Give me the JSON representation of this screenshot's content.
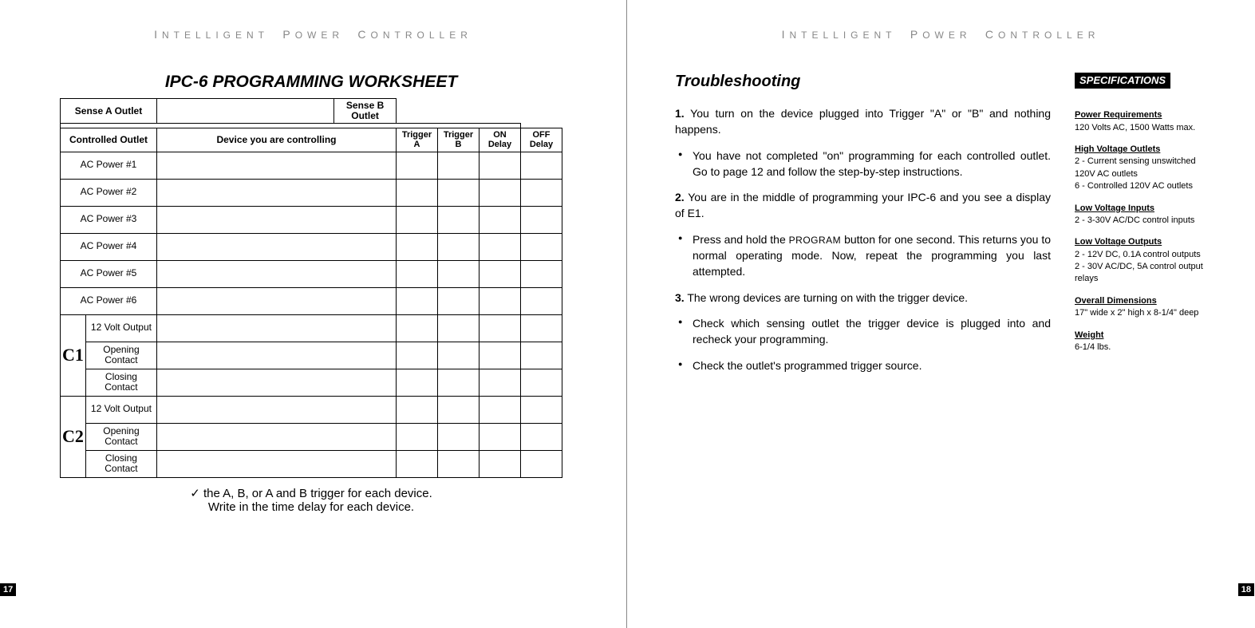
{
  "header": {
    "text": "Intelligent Power Controller"
  },
  "leftPage": {
    "pageNumber": "17",
    "title": "IPC-6 PROGRAMMING WORKSHEET",
    "senseA": "Sense A Outlet",
    "senseB": "Sense B Outlet",
    "colHeaders": {
      "outlet": "Controlled Outlet",
      "device": "Device you are controlling",
      "triggerA": "Trigger A",
      "triggerB": "Trigger B",
      "onDelay": "ON Delay",
      "offDelay": "OFF Delay"
    },
    "rowsSimple": [
      "AC Power #1",
      "AC Power #2",
      "AC Power #3",
      "AC Power #4",
      "AC Power #5",
      "AC Power #6"
    ],
    "groupLabels": {
      "c1": "C1",
      "c2": "C2"
    },
    "groupRows": [
      "12 Volt Output",
      "Opening Contact",
      "Closing Contact"
    ],
    "footnote1": "✓ the A, B, or A and B trigger for each device.",
    "footnote2": "Write in the time delay for each device."
  },
  "rightPage": {
    "pageNumber": "18",
    "tshootTitle": "Troubleshooting",
    "items": [
      {
        "num": "1.",
        "text": "You turn on the device plugged into Trigger \"A\" or \"B\" and nothing happens."
      },
      {
        "bullet": true,
        "text": "You have not completed \"on\" programming for each controlled outlet. Go to page 12 and follow the step-by-step instructions."
      },
      {
        "num": "2.",
        "text": "You are in the middle of programming your IPC-6 and you see a display of E1."
      },
      {
        "bullet": true,
        "textPre": "Press and hold the ",
        "sc": "PROGRAM",
        "textPost": " button for one second. This returns you to normal operating mode. Now, repeat the programming you last attempted."
      },
      {
        "num": "3.",
        "text": "The wrong devices are turning on with the trigger device."
      },
      {
        "bullet": true,
        "text": "Check which sensing outlet the trigger device is plugged into and recheck your programming."
      },
      {
        "bullet": true,
        "text": "Check the outlet's programmed trigger source."
      }
    ],
    "specs": {
      "title": "SPECIFICATIONS",
      "sections": [
        {
          "h": "Power Requirements",
          "t": "120 Volts AC, 1500 Watts max."
        },
        {
          "h": "High Voltage Outlets",
          "t": "2 - Current sensing unswitched 120V AC outlets\n6 - Controlled 120V AC outlets"
        },
        {
          "h": "Low Voltage Inputs",
          "t": "2 - 3-30V AC/DC control inputs"
        },
        {
          "h": "Low Voltage Outputs",
          "t": "2 - 12V DC, 0.1A control outputs\n2 - 30V AC/DC, 5A control output relays"
        },
        {
          "h": "Overall Dimensions",
          "t": "17\" wide x 2\" high x 8-1/4\" deep"
        },
        {
          "h": "Weight",
          "t": "6-1/4 lbs."
        }
      ]
    }
  }
}
